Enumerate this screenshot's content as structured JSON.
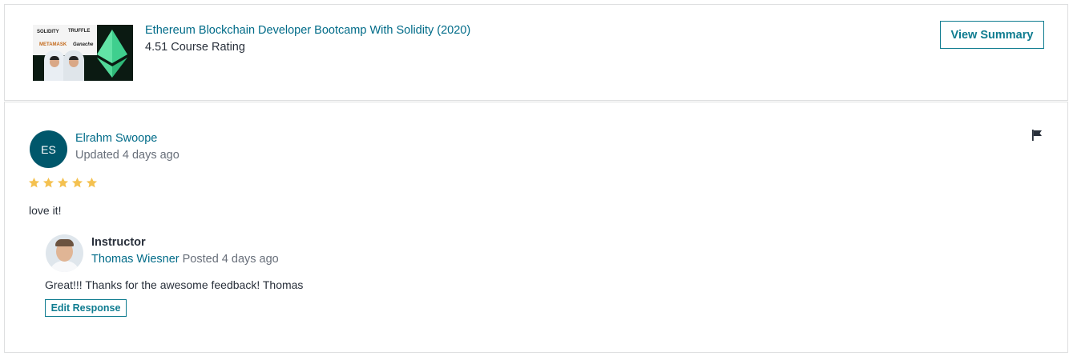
{
  "course": {
    "title": "Ethereum Blockchain Developer Bootcamp With Solidity (2020)",
    "rating_text": "4.51 Course Rating",
    "view_summary_label": "View Summary",
    "thumbnail_logos": [
      "SOLIDITY",
      "TRUFFLE",
      "METAMASK",
      "Ganache"
    ]
  },
  "review": {
    "avatar_initials": "ES",
    "avatar_color": "#00576b",
    "reviewer_name": "Elrahm Swoope",
    "timestamp": "Updated 4 days ago",
    "rating": 5,
    "star_color": "#f4c150",
    "text": "love it!",
    "flag_icon": "flag-icon"
  },
  "response": {
    "role": "Instructor",
    "instructor_name": "Thomas Wiesner",
    "posted": "Posted 4 days ago",
    "text": "Great!!! Thanks for the awesome feedback! Thomas",
    "edit_label": "Edit Response"
  },
  "colors": {
    "link": "#006b88",
    "accent": "#0f7c90",
    "muted": "#686f7a",
    "text": "#29303b"
  }
}
